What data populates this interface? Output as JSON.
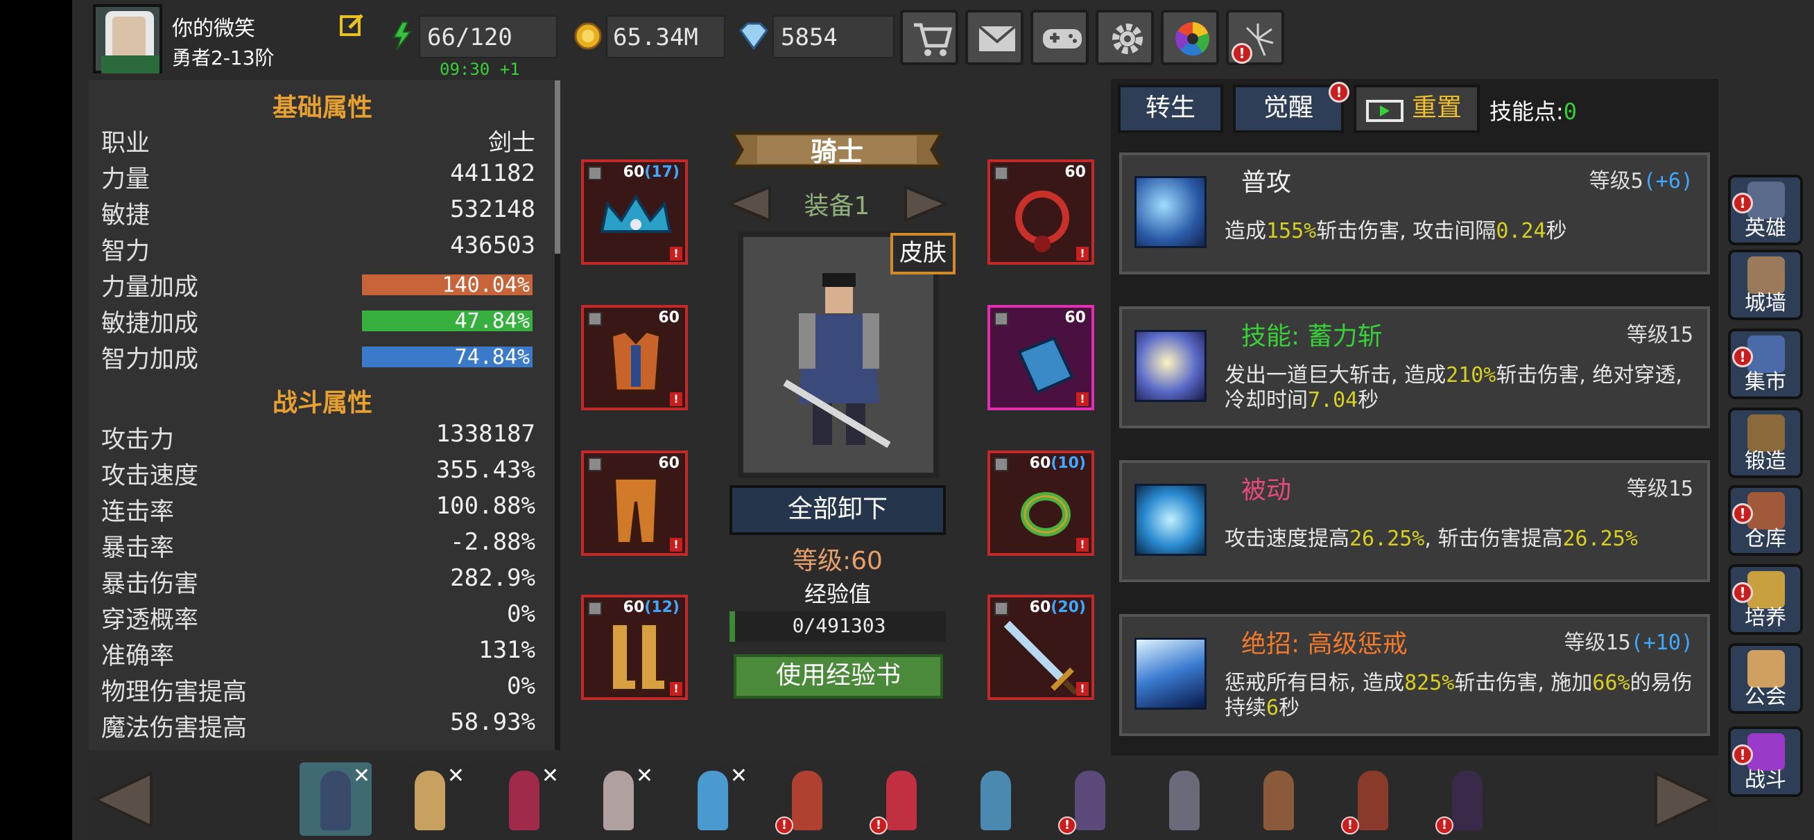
{
  "player": {
    "name": "你的微笑",
    "rank": "勇者2-13阶"
  },
  "resources": {
    "stamina": "66/120",
    "stamina_timer": "09:30 +1",
    "gold": "65.34M",
    "diamonds": "5854"
  },
  "toolbar": [
    "shop",
    "mail",
    "gamepad",
    "settings",
    "color-wheel",
    "fireworks"
  ],
  "basic": {
    "title": "基础属性",
    "rows": [
      {
        "label": "职业",
        "value": "剑士"
      },
      {
        "label": "力量",
        "value": "441182"
      },
      {
        "label": "敏捷",
        "value": "532148"
      },
      {
        "label": "智力",
        "value": "436503"
      }
    ],
    "bonuses": [
      {
        "label": "力量加成",
        "value": "140.04%",
        "color": "#c8643a"
      },
      {
        "label": "敏捷加成",
        "value": "47.84%",
        "color": "#38b040"
      },
      {
        "label": "智力加成",
        "value": "74.84%",
        "color": "#3a7ac8"
      }
    ]
  },
  "combat": {
    "title": "战斗属性",
    "rows": [
      {
        "label": "攻击力",
        "value": "1338187"
      },
      {
        "label": "攻击速度",
        "value": "355.43%"
      },
      {
        "label": "连击率",
        "value": "100.88%"
      },
      {
        "label": "暴击率",
        "value": "-2.88%"
      },
      {
        "label": "暴击伤害",
        "value": "282.9%"
      },
      {
        "label": "穿透概率",
        "value": "0%"
      },
      {
        "label": "准确率",
        "value": "131%"
      },
      {
        "label": "物理伤害提高",
        "value": "0%"
      },
      {
        "label": "魔法伤害提高",
        "value": "58.93%"
      }
    ]
  },
  "equipment": {
    "class_name": "骑士",
    "set_label": "装备1",
    "skin_label": "皮肤",
    "unequip_label": "全部卸下",
    "level_text": "等级:60",
    "exp_label": "经验值",
    "exp_value": "0/491303",
    "exp_book_label": "使用经验书",
    "slots": [
      {
        "level": "60",
        "plus": "(17)"
      },
      {
        "level": "60",
        "plus": ""
      },
      {
        "level": "60",
        "plus": ""
      },
      {
        "level": "60",
        "plus": "(12)"
      },
      {
        "level": "60",
        "plus": ""
      },
      {
        "level": "60",
        "plus": ""
      },
      {
        "level": "60",
        "plus": "(10)"
      },
      {
        "level": "60",
        "plus": "(20)"
      }
    ]
  },
  "skills_panel": {
    "tabs": [
      "转生",
      "觉醒"
    ],
    "reset_label": "重置",
    "points_label": "技能点:",
    "points_value": "0",
    "skills": [
      {
        "name": "普攻",
        "name_color": "#f0f0f0",
        "level": "等级5",
        "level_plus": "(+6)",
        "desc": [
          {
            "t": "造成"
          },
          {
            "t": "155%",
            "hl": true
          },
          {
            "t": "斩击伤害, 攻击间隔"
          },
          {
            "t": "0.24",
            "hl": true
          },
          {
            "t": "秒"
          }
        ]
      },
      {
        "name": "技能: 蓄力斩",
        "name_color": "#38d038",
        "level": "等级15",
        "level_plus": "",
        "desc": [
          {
            "t": "发出一道巨大斩击, 造成"
          },
          {
            "t": "210%",
            "hl": true
          },
          {
            "t": "斩击伤害, 绝对穿透, 冷却时间"
          },
          {
            "t": "7.04",
            "hl": true
          },
          {
            "t": "秒"
          }
        ]
      },
      {
        "name": "被动",
        "name_color": "#e84a7a",
        "level": "等级15",
        "level_plus": "",
        "desc": [
          {
            "t": "攻击速度提高"
          },
          {
            "t": "26.25%",
            "hl": true
          },
          {
            "t": ", 斩击伤害提高"
          },
          {
            "t": "26.25%",
            "hl": true
          }
        ]
      },
      {
        "name": "绝招: 高级惩戒",
        "name_color": "#f07a2a",
        "level": "等级15",
        "level_plus": "(+10)",
        "desc": [
          {
            "t": "惩戒所有目标, 造成"
          },
          {
            "t": "825%",
            "hl": true
          },
          {
            "t": "斩击伤害, 施加"
          },
          {
            "t": "66%",
            "hl": true
          },
          {
            "t": "的易伤持续"
          },
          {
            "t": "6",
            "hl": true
          },
          {
            "t": "秒"
          }
        ]
      }
    ]
  },
  "nav": [
    {
      "label": "英雄",
      "icon": "helmet-icon",
      "alert": true
    },
    {
      "label": "城墙",
      "icon": "castle-icon",
      "alert": false
    },
    {
      "label": "集市",
      "icon": "market-icon",
      "alert": true
    },
    {
      "label": "锻造",
      "icon": "anvil-icon",
      "alert": false
    },
    {
      "label": "仓库",
      "icon": "chest-icon",
      "alert": true
    },
    {
      "label": "培养",
      "icon": "chalice-icon",
      "alert": true
    },
    {
      "label": "公会",
      "icon": "guild-icon",
      "alert": false
    },
    {
      "label": "战斗",
      "icon": "portal-icon",
      "alert": true
    }
  ],
  "heroes": [
    {
      "color": "#3a4a6a",
      "removable": true,
      "alert": false,
      "selected": true
    },
    {
      "color": "#c8a060",
      "removable": true,
      "alert": false
    },
    {
      "color": "#a02a4a",
      "removable": true,
      "alert": false
    },
    {
      "color": "#b0a0a0",
      "removable": true,
      "alert": false
    },
    {
      "color": "#4a9ad0",
      "removable": true,
      "alert": false
    },
    {
      "color": "#b04030",
      "removable": false,
      "alert": true
    },
    {
      "color": "#c03040",
      "removable": false,
      "alert": true
    },
    {
      "color": "#4a8ab0",
      "removable": false,
      "alert": false
    },
    {
      "color": "#5a4a7a",
      "removable": false,
      "alert": true
    },
    {
      "color": "#6a6a7a",
      "removable": false,
      "alert": false
    },
    {
      "color": "#8a5a3a",
      "removable": false,
      "alert": false
    },
    {
      "color": "#8a3a2a",
      "removable": false,
      "alert": true
    },
    {
      "color": "#3a2a4a",
      "removable": false,
      "alert": true
    }
  ]
}
